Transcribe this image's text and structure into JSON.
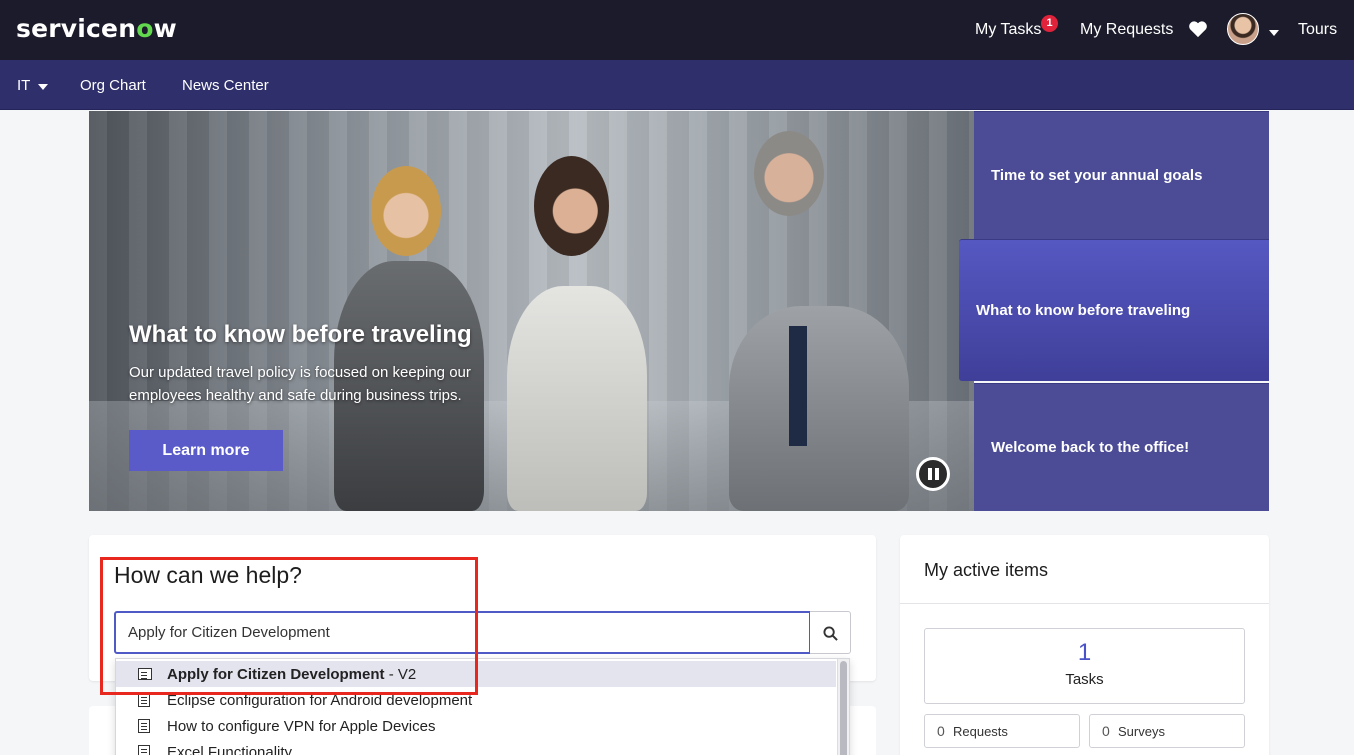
{
  "header": {
    "logo_text_a": "servicen",
    "logo_text_o": "o",
    "logo_text_b": "w",
    "my_tasks": "My Tasks",
    "tasks_badge": "1",
    "my_requests": "My Requests",
    "tours": "Tours"
  },
  "subnav": {
    "items": [
      "IT",
      "Org Chart",
      "News Center"
    ]
  },
  "hero": {
    "title": "What to know before traveling",
    "description": "Our updated travel policy is focused on keeping our employees healthy and safe during business trips.",
    "cta": "Learn more",
    "tabs": [
      {
        "label": "Time to set your annual goals"
      },
      {
        "label": "What to know before traveling"
      },
      {
        "label": "Welcome back to the office!"
      }
    ]
  },
  "search": {
    "title": "How can we help?",
    "query": "Apply for Citizen Development",
    "results": [
      {
        "bold": "Apply for Citizen Development",
        "suffix": " - V2",
        "icon": "catalog-item-icon"
      },
      {
        "bold": "",
        "suffix": "Eclipse configuration for Android development",
        "icon": "article-icon"
      },
      {
        "bold": "",
        "suffix": "How to configure VPN for Apple Devices",
        "icon": "article-icon"
      },
      {
        "bold": "",
        "suffix": "Excel Functionality",
        "icon": "article-icon"
      }
    ]
  },
  "active_items": {
    "title": "My active items",
    "tasks_count": "1",
    "tasks_label": "Tasks",
    "requests_count": "0",
    "requests_label": "Requests",
    "surveys_count": "0",
    "surveys_label": "Surveys"
  },
  "colors": {
    "header_bg": "#1b1b2b",
    "subnav_bg": "#2f2f6b",
    "accent": "#4f5ac7",
    "badge": "#e0223a",
    "highlight_box": "#e8281e"
  }
}
